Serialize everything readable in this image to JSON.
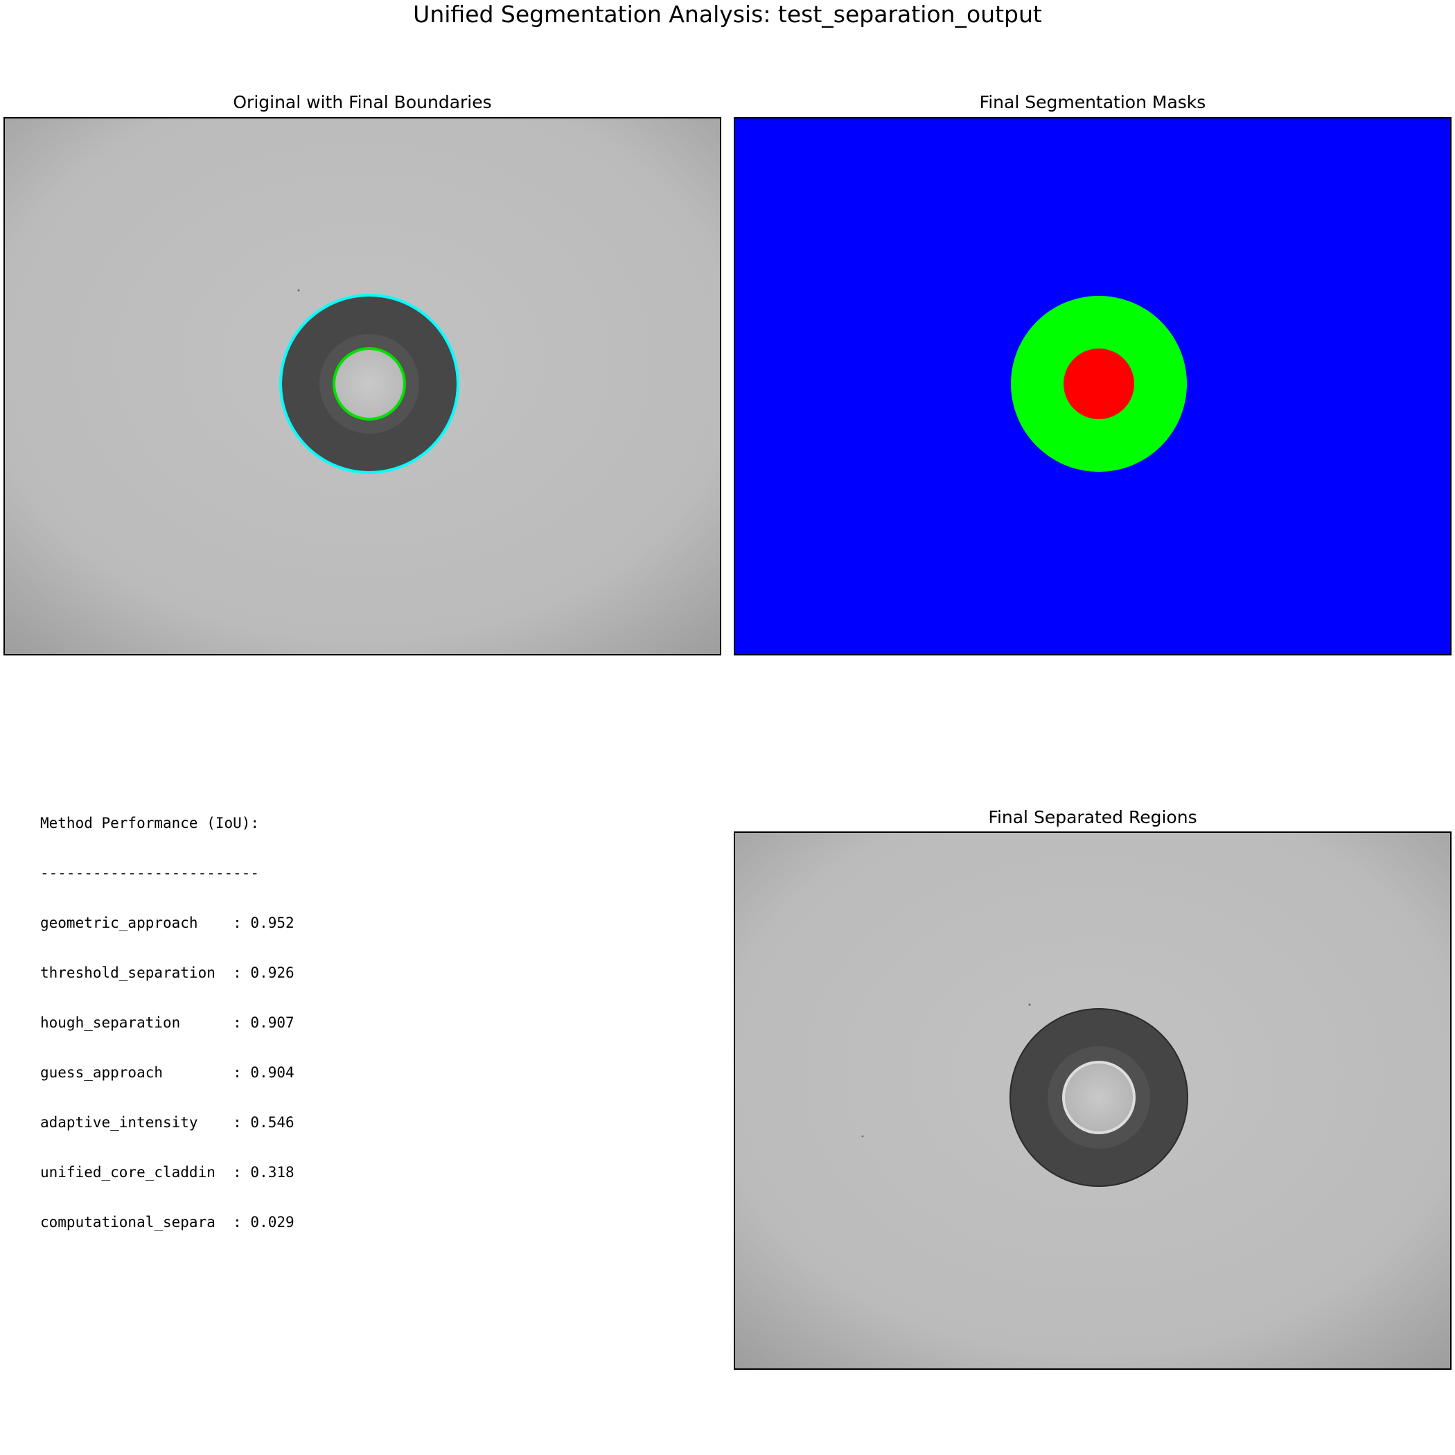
{
  "figure": {
    "title": "Unified Segmentation Analysis: test_separation_output"
  },
  "panels": {
    "original": {
      "title": "Original with Final Boundaries"
    },
    "masks": {
      "title": "Final Segmentation Masks"
    },
    "separated": {
      "title": "Final Separated Regions"
    }
  },
  "performance": {
    "heading": "Method Performance (IoU):",
    "divider": "-------------------------",
    "rows": [
      {
        "line": "geometric_approach    : 0.952",
        "method": "geometric_approach",
        "iou": 0.952
      },
      {
        "line": "threshold_separation  : 0.926",
        "method": "threshold_separation",
        "iou": 0.926
      },
      {
        "line": "hough_separation      : 0.907",
        "method": "hough_separation",
        "iou": 0.907
      },
      {
        "line": "guess_approach        : 0.904",
        "method": "guess_approach",
        "iou": 0.904
      },
      {
        "line": "adaptive_intensity    : 0.546",
        "method": "adaptive_intensity",
        "iou": 0.546
      },
      {
        "line": "unified_core_claddin  : 0.318",
        "method": "unified_core_claddin",
        "iou": 0.318
      },
      {
        "line": "computational_separa  : 0.029",
        "method": "computational_separa",
        "iou": 0.029
      }
    ]
  },
  "colors": {
    "mask_background": "#0000ff",
    "mask_cladding": "#00ff00",
    "mask_core": "#ff0000",
    "cladding_boundary": "#00ffff",
    "core_boundary": "#00e000",
    "fiber_dark": "#474747",
    "core_light": "#c4c4c4",
    "background_gray": "#bcbcbc"
  }
}
